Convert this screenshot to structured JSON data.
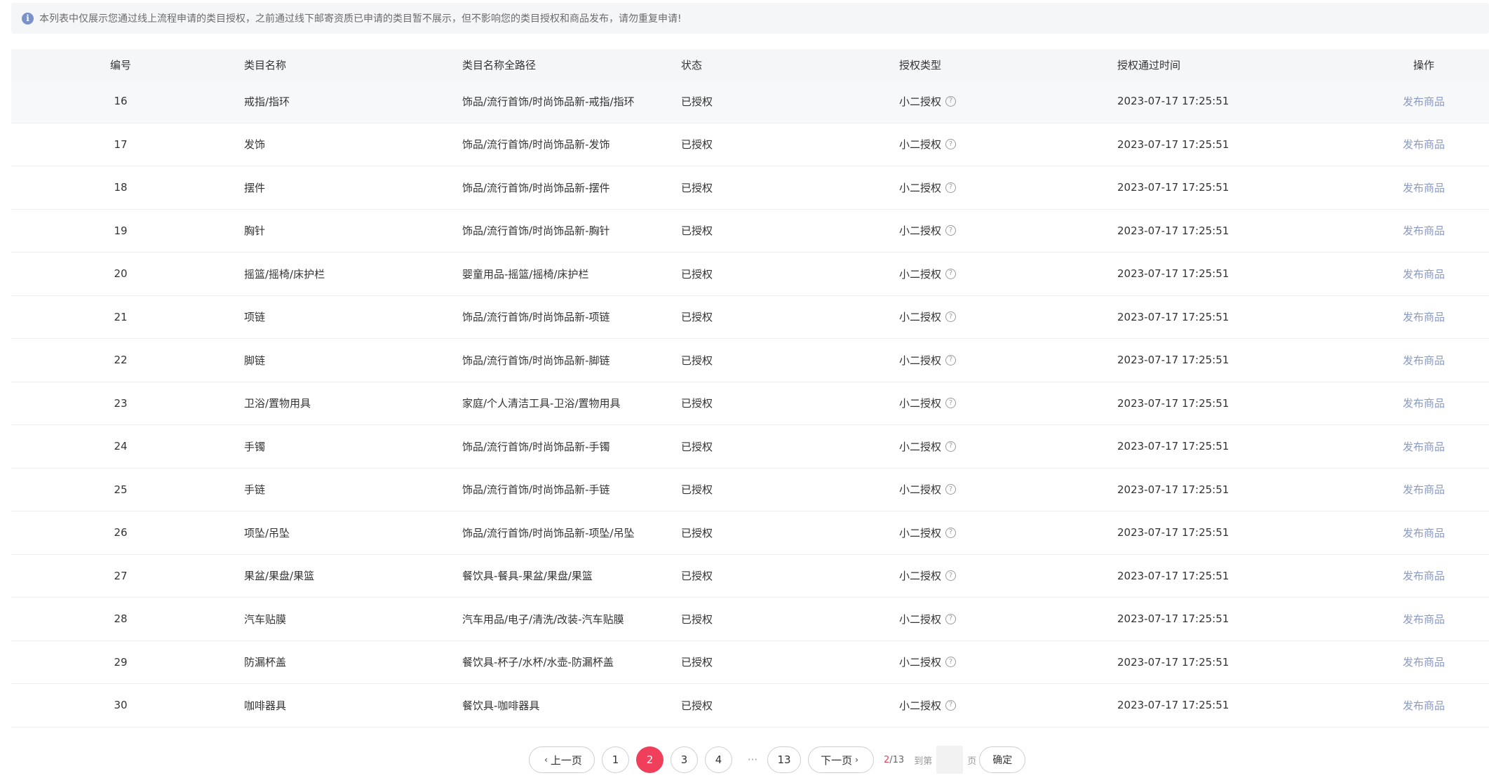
{
  "notice": {
    "icon": "info-icon",
    "text": "本列表中仅展示您通过线上流程申请的类目授权，之前通过线下邮寄资质已申请的类目暂不展示，但不影响您的类目授权和商品发布，请勿重复申请!"
  },
  "table": {
    "headers": {
      "id": "编号",
      "name": "类目名称",
      "path": "类目名称全路径",
      "status": "状态",
      "type": "授权类型",
      "time": "授权通过时间",
      "op": "操作"
    },
    "rows": [
      {
        "id": "16",
        "name": "戒指/指环",
        "path": "饰品/流行首饰/时尚饰品新-戒指/指环",
        "status": "已授权",
        "type": "小二授权",
        "time": "2023-07-17 17:25:51",
        "op": "发布商品"
      },
      {
        "id": "17",
        "name": "发饰",
        "path": "饰品/流行首饰/时尚饰品新-发饰",
        "status": "已授权",
        "type": "小二授权",
        "time": "2023-07-17 17:25:51",
        "op": "发布商品"
      },
      {
        "id": "18",
        "name": "摆件",
        "path": "饰品/流行首饰/时尚饰品新-摆件",
        "status": "已授权",
        "type": "小二授权",
        "time": "2023-07-17 17:25:51",
        "op": "发布商品"
      },
      {
        "id": "19",
        "name": "胸针",
        "path": "饰品/流行首饰/时尚饰品新-胸针",
        "status": "已授权",
        "type": "小二授权",
        "time": "2023-07-17 17:25:51",
        "op": "发布商品"
      },
      {
        "id": "20",
        "name": "摇篮/摇椅/床护栏",
        "path": "婴童用品-摇篮/摇椅/床护栏",
        "status": "已授权",
        "type": "小二授权",
        "time": "2023-07-17 17:25:51",
        "op": "发布商品"
      },
      {
        "id": "21",
        "name": "项链",
        "path": "饰品/流行首饰/时尚饰品新-项链",
        "status": "已授权",
        "type": "小二授权",
        "time": "2023-07-17 17:25:51",
        "op": "发布商品"
      },
      {
        "id": "22",
        "name": "脚链",
        "path": "饰品/流行首饰/时尚饰品新-脚链",
        "status": "已授权",
        "type": "小二授权",
        "time": "2023-07-17 17:25:51",
        "op": "发布商品"
      },
      {
        "id": "23",
        "name": "卫浴/置物用具",
        "path": "家庭/个人清洁工具-卫浴/置物用具",
        "status": "已授权",
        "type": "小二授权",
        "time": "2023-07-17 17:25:51",
        "op": "发布商品"
      },
      {
        "id": "24",
        "name": "手镯",
        "path": "饰品/流行首饰/时尚饰品新-手镯",
        "status": "已授权",
        "type": "小二授权",
        "time": "2023-07-17 17:25:51",
        "op": "发布商品"
      },
      {
        "id": "25",
        "name": "手链",
        "path": "饰品/流行首饰/时尚饰品新-手链",
        "status": "已授权",
        "type": "小二授权",
        "time": "2023-07-17 17:25:51",
        "op": "发布商品"
      },
      {
        "id": "26",
        "name": "项坠/吊坠",
        "path": "饰品/流行首饰/时尚饰品新-项坠/吊坠",
        "status": "已授权",
        "type": "小二授权",
        "time": "2023-07-17 17:25:51",
        "op": "发布商品"
      },
      {
        "id": "27",
        "name": "果盆/果盘/果篮",
        "path": "餐饮具-餐具-果盆/果盘/果篮",
        "status": "已授权",
        "type": "小二授权",
        "time": "2023-07-17 17:25:51",
        "op": "发布商品"
      },
      {
        "id": "28",
        "name": "汽车贴膜",
        "path": "汽车用品/电子/清洗/改装-汽车贴膜",
        "status": "已授权",
        "type": "小二授权",
        "time": "2023-07-17 17:25:51",
        "op": "发布商品"
      },
      {
        "id": "29",
        "name": "防漏杯盖",
        "path": "餐饮具-杯子/水杯/水壶-防漏杯盖",
        "status": "已授权",
        "type": "小二授权",
        "time": "2023-07-17 17:25:51",
        "op": "发布商品"
      },
      {
        "id": "30",
        "name": "咖啡器具",
        "path": "餐饮具-咖啡器具",
        "status": "已授权",
        "type": "小二授权",
        "time": "2023-07-17 17:25:51",
        "op": "发布商品"
      }
    ]
  },
  "pagination": {
    "prev_label": "上一页",
    "next_label": "下一页",
    "pages": [
      "1",
      "2",
      "3",
      "4"
    ],
    "ellipsis": "···",
    "last_page": "13",
    "current_page": "2",
    "page_info_current": "2",
    "page_info_total": "/13",
    "goto_label": "到第",
    "goto_value": "",
    "page_suffix": "页",
    "confirm_label": "确定",
    "active_color": "#ef3f5b"
  }
}
